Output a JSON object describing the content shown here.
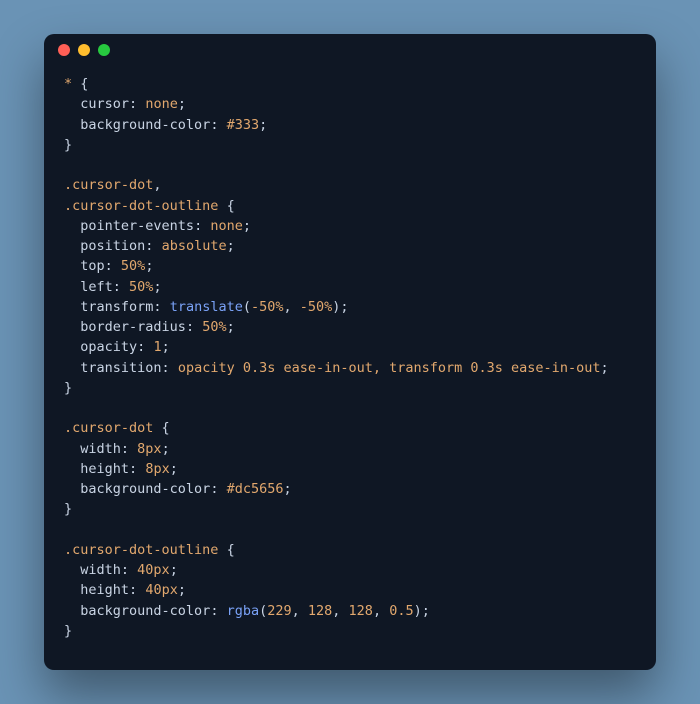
{
  "code": {
    "rules": [
      {
        "selectors": [
          "*"
        ],
        "decls": [
          {
            "prop": "cursor",
            "value": "none"
          },
          {
            "prop": "background-color",
            "value": "#333"
          }
        ]
      },
      {
        "selectors": [
          ".cursor-dot",
          ".cursor-dot-outline"
        ],
        "decls": [
          {
            "prop": "pointer-events",
            "value": "none"
          },
          {
            "prop": "position",
            "value": "absolute"
          },
          {
            "prop": "top",
            "value": "50%"
          },
          {
            "prop": "left",
            "value": "50%"
          },
          {
            "prop": "transform",
            "fn": "translate",
            "args": [
              "-50%",
              "-50%"
            ]
          },
          {
            "prop": "border-radius",
            "value": "50%"
          },
          {
            "prop": "opacity",
            "value": "1"
          },
          {
            "prop": "transition",
            "value": "opacity 0.3s ease-in-out, transform 0.3s ease-in-out"
          }
        ]
      },
      {
        "selectors": [
          ".cursor-dot"
        ],
        "decls": [
          {
            "prop": "width",
            "value": "8px"
          },
          {
            "prop": "height",
            "value": "8px"
          },
          {
            "prop": "background-color",
            "value": "#dc5656"
          }
        ]
      },
      {
        "selectors": [
          ".cursor-dot-outline"
        ],
        "decls": [
          {
            "prop": "width",
            "value": "40px"
          },
          {
            "prop": "height",
            "value": "40px"
          },
          {
            "prop": "background-color",
            "fn": "rgba",
            "args": [
              "229",
              "128",
              "128",
              "0.5"
            ]
          }
        ]
      }
    ]
  }
}
